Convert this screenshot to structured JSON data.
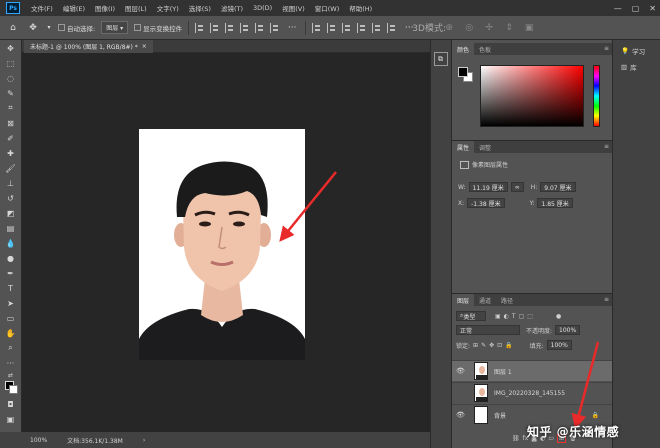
{
  "menubar": {
    "app_logo": "Ps",
    "items": [
      "文件(F)",
      "编辑(E)",
      "图像(I)",
      "图层(L)",
      "文字(Y)",
      "选择(S)",
      "滤镜(T)",
      "3D(D)",
      "视图(V)",
      "窗口(W)",
      "帮助(H)"
    ],
    "window_controls": [
      "minimize-icon",
      "maximize-icon",
      "close-icon"
    ]
  },
  "options_bar": {
    "auto_select_label": "自动选择:",
    "auto_select_target": "图层",
    "show_transform_label": "显示变换控件"
  },
  "document": {
    "tab_title": "未标题-1 @ 100% (图层 1, RGB/8#) *",
    "tab_close": "×",
    "status_zoom": "100%",
    "status_info": "文档:356.1K/1.38M"
  },
  "panels": {
    "color": {
      "tabs": [
        "颜色",
        "色板"
      ],
      "foreground": "#000000",
      "background": "#ffffff"
    },
    "properties": {
      "tabs": [
        "属性",
        "调整"
      ],
      "section_title": "像素图层属性",
      "w_label": "W:",
      "w_value": "11.19 厘米",
      "h_label": "H:",
      "h_value": "9.07 厘米",
      "x_label": "X:",
      "x_value": "-1.38 厘米",
      "y_label": "Y:",
      "y_value": "1.85 厘米",
      "link_glyph": "∞"
    },
    "layers": {
      "tabs": [
        "图层",
        "通道",
        "路径"
      ],
      "filter_kind": "类型",
      "blend_mode": "正常",
      "opacity_label": "不透明度:",
      "opacity_value": "100%",
      "lock_label": "锁定:",
      "fill_label": "填充:",
      "fill_value": "100%",
      "items": [
        {
          "name": "图层 1",
          "selected": true
        },
        {
          "name": "IMG_20220328_145155",
          "selected": false
        },
        {
          "name": "背景",
          "selected": false
        }
      ],
      "footer_fx": "fx"
    }
  },
  "far_right": {
    "items": [
      {
        "icon": "lightbulb-icon",
        "label": "学习"
      },
      {
        "icon": "library-icon",
        "label": "库"
      }
    ]
  },
  "watermark": "知乎 @乐涵情感"
}
